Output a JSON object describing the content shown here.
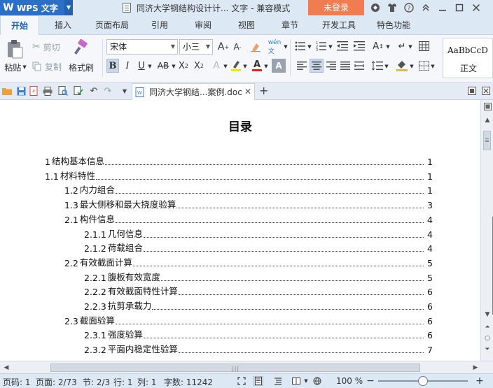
{
  "titlebar": {
    "app_name": "WPS 文字",
    "doc_title": "同济大学钢结构设计计... 文字 - 兼容模式",
    "login_label": "未登录"
  },
  "tabs": [
    "开始",
    "插入",
    "页面布局",
    "引用",
    "审阅",
    "视图",
    "章节",
    "开发工具",
    "特色功能"
  ],
  "ribbon": {
    "paste_label": "粘贴",
    "cut_label": "剪切",
    "copy_label": "复制",
    "format_painter_label": "格式刷",
    "font_name": "宋体",
    "font_size": "小三",
    "style_sample": "AaBbCcD",
    "style_name": "正文"
  },
  "quickbar": {
    "doc_tab_label": "同济大学钢结...案例.doc"
  },
  "document": {
    "heading": "目录",
    "toc": [
      {
        "num": "1",
        "text": "结构基本信息",
        "page": "1"
      },
      {
        "num": "1.1",
        "text": "材料特性",
        "page": "1"
      },
      {
        "num": "1.2",
        "text": "内力组合",
        "page": "1"
      },
      {
        "num": "1.3",
        "text": "最大侧移和最大挠度验算",
        "page": "3"
      },
      {
        "num": "2.1",
        "text": "构件信息",
        "page": "4"
      },
      {
        "num": "2.1.1",
        "text": "几何信息",
        "page": "4"
      },
      {
        "num": "2.1.2",
        "text": "荷载组合",
        "page": "4"
      },
      {
        "num": "2.2",
        "text": "有效截面计算",
        "page": "5"
      },
      {
        "num": "2.2.1",
        "text": "腹板有效宽度",
        "page": "5"
      },
      {
        "num": "2.2.2",
        "text": "有效截面特性计算",
        "page": "6"
      },
      {
        "num": "2.2.3",
        "text": "抗剪承载力",
        "page": "6"
      },
      {
        "num": "2.3",
        "text": "截面验算",
        "page": "6"
      },
      {
        "num": "2.3.1",
        "text": "强度验算",
        "page": "6"
      },
      {
        "num": "2.3.2",
        "text": "平面内稳定性验算",
        "page": "7"
      }
    ]
  },
  "statusbar": {
    "page_code": "页码: 1",
    "page": "页面: 2/73",
    "section": "节: 2/3",
    "row": "行: 1",
    "col": "列: 1",
    "word_count": "字数: 11242",
    "zoom": "100 %",
    "zoom_fraction": 0.5
  },
  "colors": {
    "app_blue": "#2b6fc6",
    "login_orange": "#f07d52",
    "active_tab_text": "#1e5fb8"
  }
}
